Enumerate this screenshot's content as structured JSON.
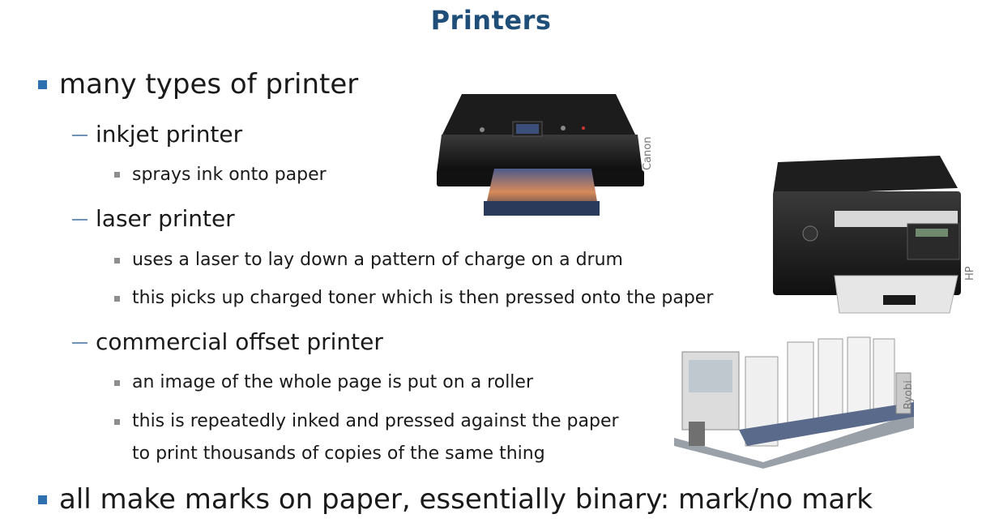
{
  "slide": {
    "title": "Printers",
    "bullets": {
      "b1": "many types of printer",
      "inkjet": "inkjet printer",
      "inkjet_desc": "sprays ink onto paper",
      "laser": "laser printer",
      "laser_desc1": "uses a laser to lay down a pattern of charge on a drum",
      "laser_desc2": "this picks up charged toner which is then pressed onto the paper",
      "offset": "commercial offset printer",
      "offset_desc1": "an image of the whole page is put on a roller",
      "offset_desc2a": "this is repeatedly inked and pressed against the paper",
      "offset_desc2b": "to print thousands of copies of the same thing",
      "b2": "all make marks on paper, essentially binary: mark/no mark"
    },
    "credits": {
      "canon": "Canon",
      "hp": "HP",
      "ryobi": "Ryobi"
    },
    "icons": [
      "inkjet-printer-image",
      "laser-printer-image",
      "offset-press-image"
    ],
    "colors": {
      "title": "#1f4e79",
      "bullet": "#2e6fb0",
      "dash": "#6f93b8"
    }
  }
}
